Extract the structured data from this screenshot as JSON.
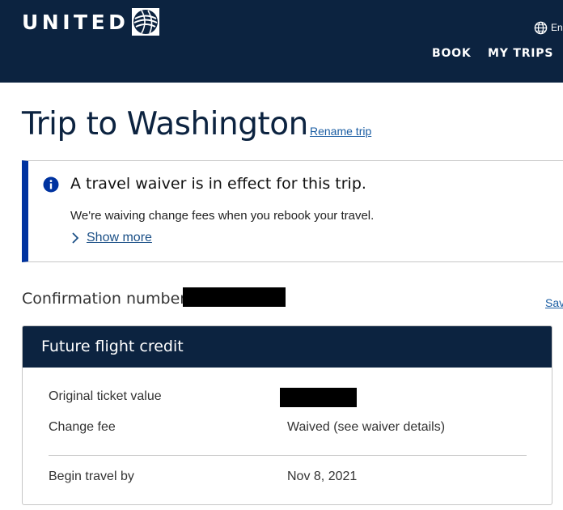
{
  "header": {
    "brand": "UNITED",
    "language_label": "En",
    "nav": [
      {
        "label": "BOOK"
      },
      {
        "label": "MY TRIPS"
      }
    ],
    "colors": {
      "navy": "#0c2340",
      "waiver_accent": "#0033a0",
      "link": "#1a5da3"
    }
  },
  "trip": {
    "title": "Trip to Washington",
    "rename_label": "Rename trip"
  },
  "waiver": {
    "icon": "info-icon",
    "heading": "A travel waiver is in effect for this trip.",
    "body": "We're waiving change fees when you rebook your travel.",
    "show_more_label": "Show more"
  },
  "confirmation": {
    "label": "Confirmation number:",
    "save_label": "Sav"
  },
  "credit": {
    "title": "Future flight credit",
    "rows": [
      {
        "label": "Original ticket value",
        "value": ""
      },
      {
        "label": "Change fee",
        "value": "Waived (see waiver details)"
      },
      {
        "label": "Begin travel by",
        "value": "Nov 8, 2021"
      }
    ]
  }
}
